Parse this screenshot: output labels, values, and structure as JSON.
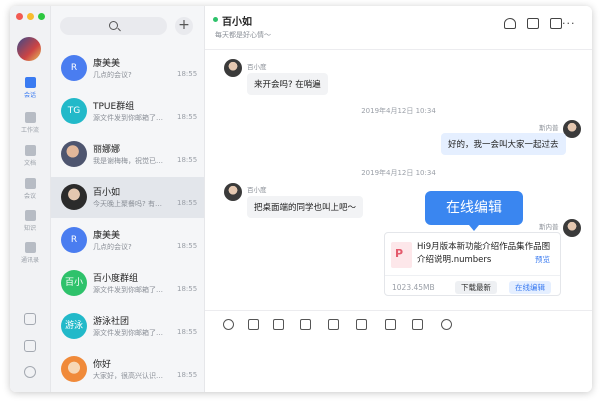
{
  "window": {
    "traffic_colors": [
      "#f25a52",
      "#f8bc2e",
      "#2dc73f"
    ]
  },
  "rail": {
    "items": [
      {
        "label": "会话",
        "icon": "chat-icon",
        "active": true
      },
      {
        "label": "工作流",
        "icon": "workflow-icon",
        "active": false
      },
      {
        "label": "文档",
        "icon": "document-icon",
        "active": false
      },
      {
        "label": "会议",
        "icon": "meeting-icon",
        "active": false
      },
      {
        "label": "知识",
        "icon": "knowledge-icon",
        "active": false
      },
      {
        "label": "通讯录",
        "icon": "contacts-icon",
        "active": false
      }
    ],
    "bottom_icons": [
      "call-icon",
      "bookmark-icon",
      "more-circle-icon"
    ]
  },
  "sidebar": {
    "add_label": "+",
    "conversations": [
      {
        "name": "康美美",
        "preview": "几点的会议?",
        "time": "18:55",
        "avatar_text": "R",
        "avatar_color": "#4a7df0"
      },
      {
        "name": "TPUE群组",
        "preview": "源文件发到你邮箱了…",
        "time": "18:55",
        "avatar_text": "TG",
        "avatar_color": "#22b9c9"
      },
      {
        "name": "丽娜娜",
        "preview": "我是谢梅梅，祝觉已…",
        "time": "18:55",
        "avatar_text": "",
        "avatar_color": "#5a5f7a"
      },
      {
        "name": "百小如",
        "preview": "今天晚上聚餐吗? 有…",
        "time": "18:55",
        "avatar_text": "",
        "avatar_color": "#2b2b2b",
        "selected": true
      },
      {
        "name": "康美美",
        "preview": "几点的会议?",
        "time": "18:55",
        "avatar_text": "R",
        "avatar_color": "#4a7df0"
      },
      {
        "name": "百小度群组",
        "preview": "源文件发到你邮箱了…",
        "time": "18:55",
        "avatar_text": "百小",
        "avatar_color": "#2ec26b"
      },
      {
        "name": "游泳社团",
        "preview": "源文件发到你邮箱了…",
        "time": "18:55",
        "avatar_text": "游泳",
        "avatar_color": "#22b9c9"
      },
      {
        "name": "你好",
        "preview": "大家好，很高兴认识…",
        "time": "18:55",
        "avatar_text": "",
        "avatar_color": "#f08a3a"
      }
    ]
  },
  "chat": {
    "title": "百小如",
    "subtitle": "每天都是好心情～",
    "toolbar_icons": [
      "add-person-icon",
      "folder-icon",
      "message-plus-icon",
      "more-icon"
    ],
    "more_label": "···",
    "messages": [
      {
        "sender": "百小度",
        "text": "来开会吗? 在哨遍",
        "mine": false
      },
      {
        "timestamp": "2019年4月12日 10:34"
      },
      {
        "sender": "斯内普",
        "text": "好的，我一会叫大家一起过去",
        "mine": true
      },
      {
        "timestamp": "2019年4月12日 10:34"
      },
      {
        "sender": "百小度",
        "text": "把桌面端的同学也叫上吧～",
        "mine": false
      },
      {
        "sender": "斯内普",
        "mine": true,
        "file": {
          "icon_text": "P",
          "name": "Hi9月版本新功能介绍作品集作品图介绍说明.numbers",
          "preview_label": "预览",
          "size": "1023.45MB",
          "download_label": "下载最新",
          "edit_label": "在线编辑"
        }
      }
    ],
    "tooltip": "在线编辑",
    "input_toolbar_icons": [
      "emoji-icon",
      "scissors-icon",
      "upload-icon",
      "contact-card-icon",
      "task-icon",
      "screen-record-icon",
      "calendar-icon",
      "voice-call-icon",
      "history-icon"
    ]
  }
}
